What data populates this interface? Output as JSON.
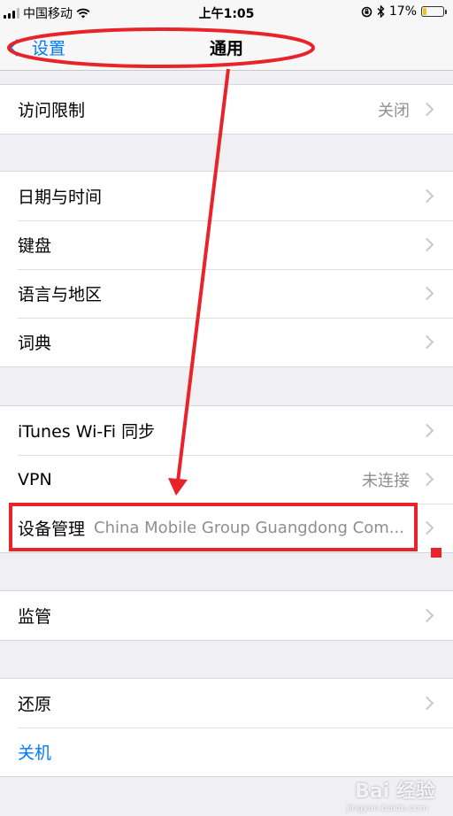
{
  "status_bar": {
    "carrier": "中国移动",
    "time": "上午1:05",
    "battery_text": "17%",
    "battery_level": 0.17
  },
  "nav": {
    "back_label": "设置",
    "title": "通用"
  },
  "groups": [
    {
      "rows": [
        {
          "label": "访问限制",
          "value": "关闭"
        }
      ]
    },
    {
      "rows": [
        {
          "label": "日期与时间"
        },
        {
          "label": "键盘"
        },
        {
          "label": "语言与地区"
        },
        {
          "label": "词典"
        }
      ]
    },
    {
      "rows": [
        {
          "label": "iTunes Wi-Fi 同步"
        },
        {
          "label": "VPN",
          "value": "未连接"
        },
        {
          "label": "设备管理",
          "value": "China Mobile Group Guangdong Com..."
        }
      ]
    },
    {
      "rows": [
        {
          "label": "监管"
        }
      ]
    },
    {
      "rows": [
        {
          "label": "还原"
        },
        {
          "label": "关机"
        }
      ]
    }
  ],
  "watermark": {
    "text": "Bai 经验",
    "sub": "jingyan.baidu.com"
  },
  "colors": {
    "accent": "#007aff",
    "annotation": "#e8232a",
    "background": "#efeff4"
  }
}
